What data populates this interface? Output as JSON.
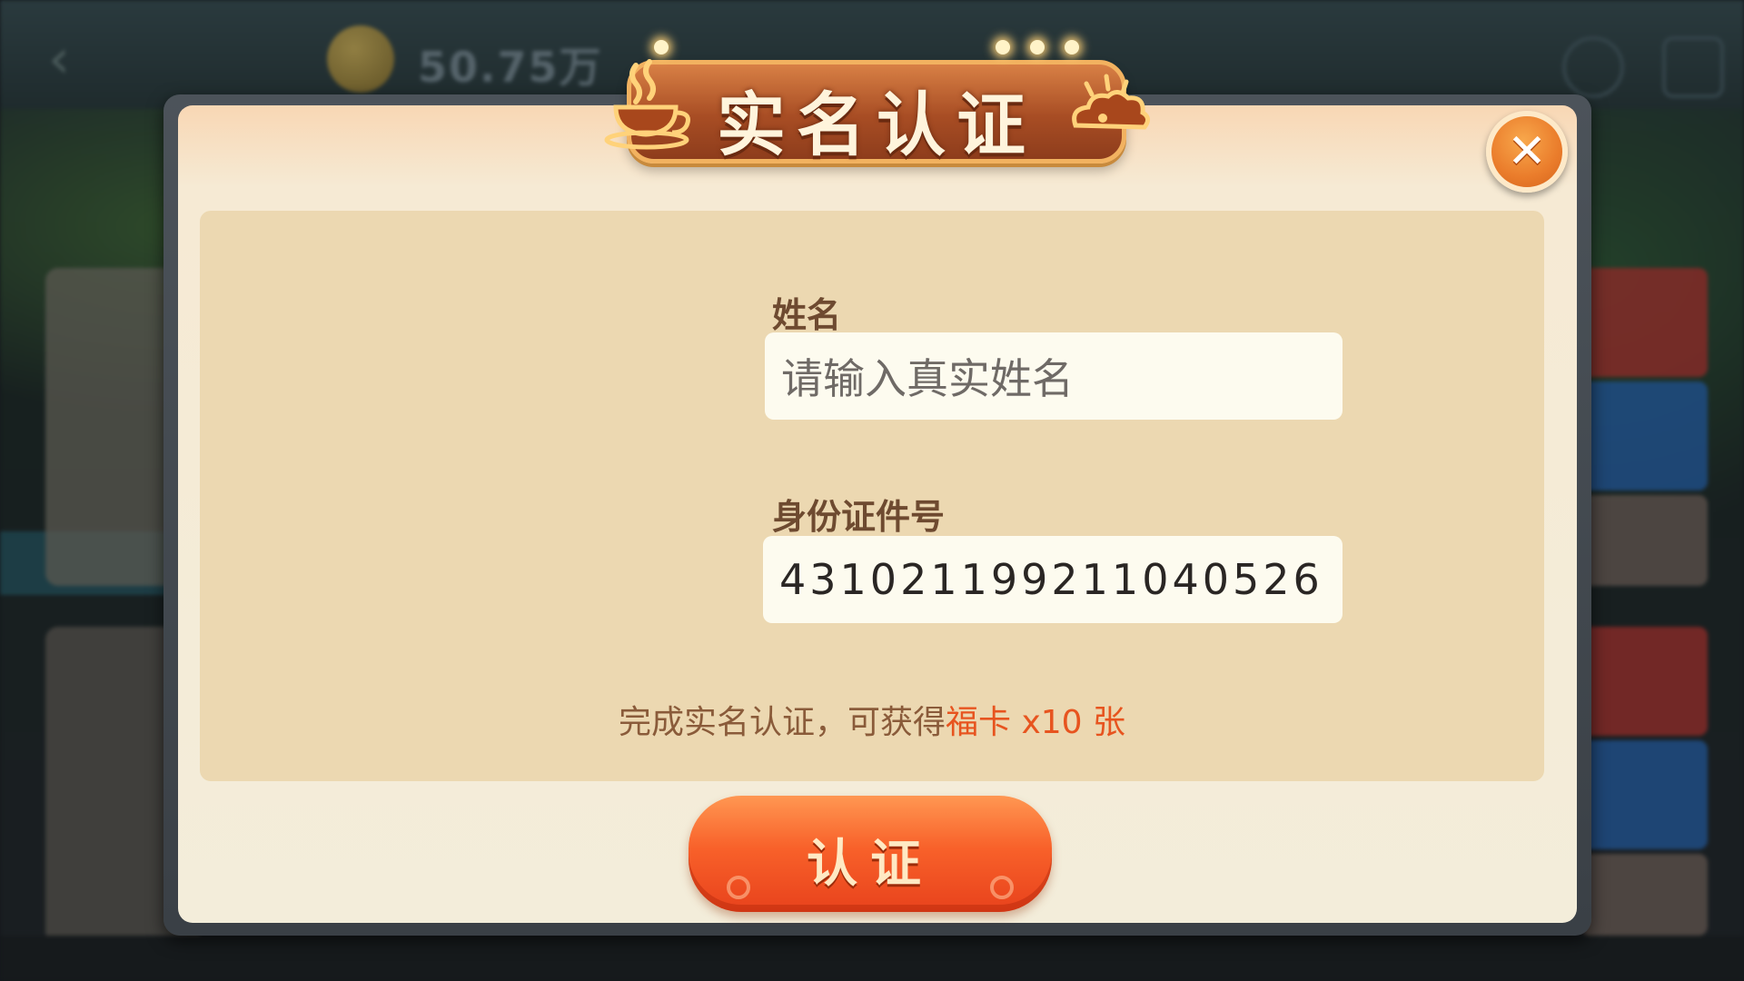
{
  "dialog": {
    "title": "实名认证",
    "name_label": "姓名",
    "name_placeholder": "请输入真实姓名",
    "id_label": "身份证件号",
    "id_value": "431021199211040526",
    "reward_text_prefix": "完成实名认证，可获得",
    "reward_highlight": "福卡 x10 张",
    "confirm_label": "认证",
    "close_icon": "close-icon",
    "title_icons": [
      "coffee-cup-icon",
      "cloud-icon"
    ]
  },
  "background": {
    "coin_amount": "50.75万"
  },
  "colors": {
    "accent_orange": "#f8612a",
    "label_brown": "#6e4a30",
    "reward_highlight": "#e7541f"
  }
}
